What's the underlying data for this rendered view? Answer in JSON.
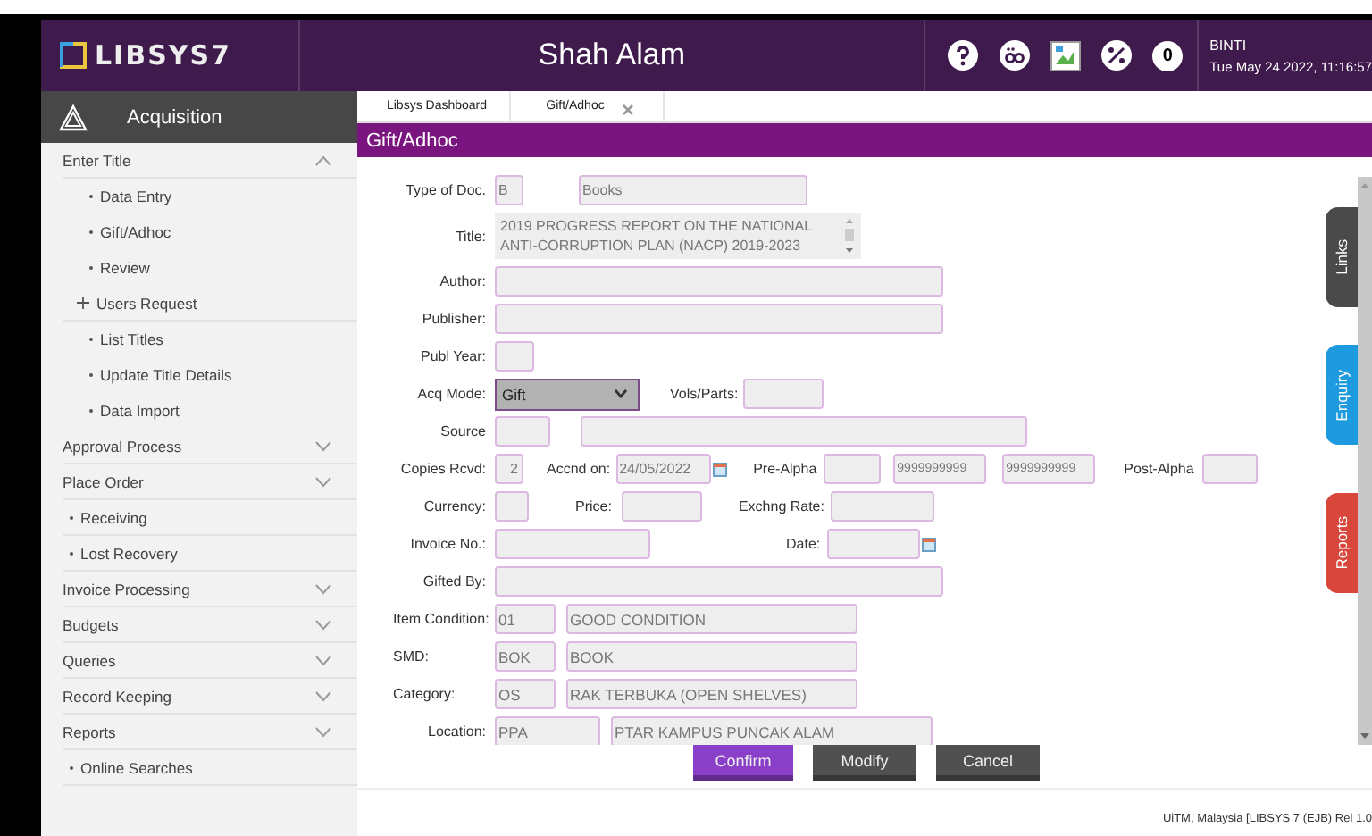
{
  "header": {
    "logo": "LIBSYS7",
    "location": "Shah Alam",
    "badge": "0",
    "user": "BINTI",
    "datetime": "Tue May 24 2022, 11:16:57"
  },
  "sidebar": {
    "module": "Acquisition",
    "menu": [
      {
        "kind": "section",
        "label": "Enter Title",
        "expanded": true,
        "children": [
          {
            "kind": "link",
            "label": "Data Entry"
          },
          {
            "kind": "link",
            "label": "Gift/Adhoc"
          },
          {
            "kind": "link",
            "label": "Review"
          },
          {
            "kind": "plus",
            "label": "Users Request"
          },
          {
            "kind": "link",
            "label": "List Titles"
          },
          {
            "kind": "link",
            "label": "Update Title Details"
          },
          {
            "kind": "link",
            "label": "Data Import"
          }
        ]
      },
      {
        "kind": "section",
        "label": "Approval Process",
        "expanded": false
      },
      {
        "kind": "section",
        "label": "Place Order",
        "expanded": false
      },
      {
        "kind": "link",
        "label": "Receiving"
      },
      {
        "kind": "link",
        "label": "Lost Recovery"
      },
      {
        "kind": "section",
        "label": "Invoice Processing",
        "expanded": false
      },
      {
        "kind": "section",
        "label": "Budgets",
        "expanded": false
      },
      {
        "kind": "section",
        "label": "Queries",
        "expanded": false
      },
      {
        "kind": "section",
        "label": "Record Keeping",
        "expanded": false
      },
      {
        "kind": "section",
        "label": "Reports",
        "expanded": false
      },
      {
        "kind": "link",
        "label": "Online Searches"
      }
    ]
  },
  "tabs": [
    {
      "label": "Libsys Dashboard",
      "closable": false
    },
    {
      "label": "Gift/Adhoc",
      "closable": true
    }
  ],
  "page_title": "Gift/Adhoc",
  "form": {
    "type_of_doc": {
      "label": "Type of Doc.",
      "code": "B",
      "name": "Books"
    },
    "title": {
      "label": "Title:",
      "value": "2019 PROGRESS REPORT ON THE NATIONAL ANTI-CORRUPTION PLAN (NACP) 2019-2023"
    },
    "author": {
      "label": "Author:"
    },
    "publisher": {
      "label": "Publisher:"
    },
    "publ_year": {
      "label": "Publ Year:"
    },
    "acq_mode": {
      "label": "Acq Mode:",
      "value": "Gift"
    },
    "vols_parts": {
      "label": "Vols/Parts:"
    },
    "source": {
      "label": "Source"
    },
    "copies_rcvd": {
      "label": "Copies Rcvd:",
      "value": "2"
    },
    "accnd_on": {
      "label": "Accnd on:",
      "value": "24/05/2022"
    },
    "pre_alpha": {
      "label": "Pre-Alpha",
      "from": "9999999999",
      "to": "9999999999"
    },
    "post_alpha": {
      "label": "Post-Alpha"
    },
    "currency": {
      "label": "Currency:"
    },
    "price": {
      "label": "Price:"
    },
    "exchng_rate": {
      "label": "Exchng Rate:"
    },
    "invoice_no": {
      "label": "Invoice No.:"
    },
    "date": {
      "label": "Date:"
    },
    "gifted_by": {
      "label": "Gifted By:"
    },
    "item_condition": {
      "label": "Item Condition:",
      "code": "01",
      "name": "GOOD CONDITION"
    },
    "smd": {
      "label": "SMD:",
      "code": "BOK",
      "name": "BOOK"
    },
    "category": {
      "label": "Category:",
      "code": "OS",
      "name": "RAK TERBUKA (OPEN SHELVES)"
    },
    "location": {
      "label": "Location:",
      "code": "PPA",
      "name": "PTAR KAMPUS PUNCAK ALAM"
    }
  },
  "buttons": [
    {
      "label": "Confirm",
      "kind": "primary"
    },
    {
      "label": "Modify",
      "kind": "secondary"
    },
    {
      "label": "Cancel",
      "kind": "secondary"
    }
  ],
  "side_tabs": [
    {
      "label": "Links",
      "color": "#4a4a4a"
    },
    {
      "label": "Enquiry",
      "color": "#1e9be0"
    },
    {
      "label": "Reports",
      "color": "#d9473c"
    }
  ],
  "footer": "UiTM, Malaysia [LIBSYS 7 (EJB) Rel 1.0"
}
